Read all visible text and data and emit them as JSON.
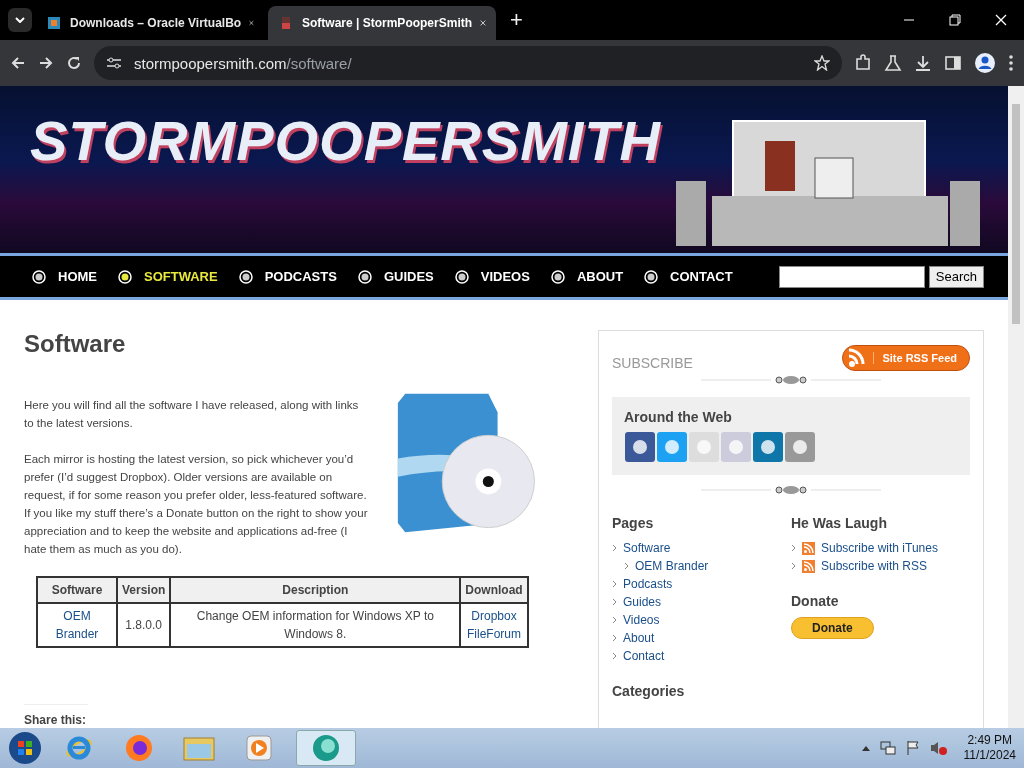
{
  "browser": {
    "tabs": [
      {
        "title": "Downloads – Oracle VirtualBo",
        "selected": false
      },
      {
        "title": "Software | StormPooperSmith",
        "selected": true
      }
    ],
    "new_tab": "+",
    "url_host": "stormpoopersmith.com",
    "url_path": "/software/"
  },
  "banner": {
    "logo": "STORMPOOPERSMITH"
  },
  "nav": {
    "items": [
      {
        "label": "HOME",
        "selected": false
      },
      {
        "label": "SOFTWARE",
        "selected": true
      },
      {
        "label": "PODCASTS",
        "selected": false
      },
      {
        "label": "GUIDES",
        "selected": false
      },
      {
        "label": "VIDEOS",
        "selected": false
      },
      {
        "label": "ABOUT",
        "selected": false
      },
      {
        "label": "CONTACT",
        "selected": false
      }
    ],
    "search_button": "Search"
  },
  "main": {
    "title": "Software",
    "paragraphs": [
      "Here you will find all the software I have released, along with links to the latest versions.",
      "Each mirror is hosting the latest version, so pick whichever you’d prefer (I’d suggest Dropbox). Older versions are available on request, if for some reason you prefer older, less-featured software. If you like my stuff there’s a Donate button on the right to show your appreciation and to keep the website and applications ad-free (I hate them as much as you do)."
    ],
    "table": {
      "columns": [
        "Software",
        "Version",
        "Description",
        "Download"
      ],
      "rows": [
        {
          "software": "OEM Brander",
          "version": "1.8.0.0",
          "description": "Change OEM information for Windows XP to Windows 8.",
          "downloads": [
            "Dropbox",
            "FileForum"
          ]
        }
      ]
    },
    "share_heading": "Share this:"
  },
  "sidebar": {
    "subscribe": "SUBSCRIBE",
    "rss_button": "Site RSS Feed",
    "around_heading": "Around the Web",
    "pages_heading": "Pages",
    "pages": [
      {
        "label": "Software",
        "children": [
          {
            "label": "OEM Brander"
          }
        ]
      },
      {
        "label": "Podcasts"
      },
      {
        "label": "Guides"
      },
      {
        "label": "Videos"
      },
      {
        "label": "About"
      },
      {
        "label": "Contact"
      }
    ],
    "podcast_heading": "He Was Laugh",
    "podcast_links": [
      "Subscribe with iTunes",
      "Subscribe with RSS"
    ],
    "donate_heading": "Donate",
    "donate_button": "Donate",
    "categories_heading": "Categories"
  },
  "taskbar": {
    "apps": [
      {
        "kind": "ie",
        "selected": false
      },
      {
        "kind": "firefox",
        "selected": false
      },
      {
        "kind": "folder",
        "selected": false
      },
      {
        "kind": "media",
        "selected": false
      },
      {
        "kind": "app",
        "selected": true
      }
    ],
    "time": "2:49 PM",
    "date": "11/1/2024"
  }
}
